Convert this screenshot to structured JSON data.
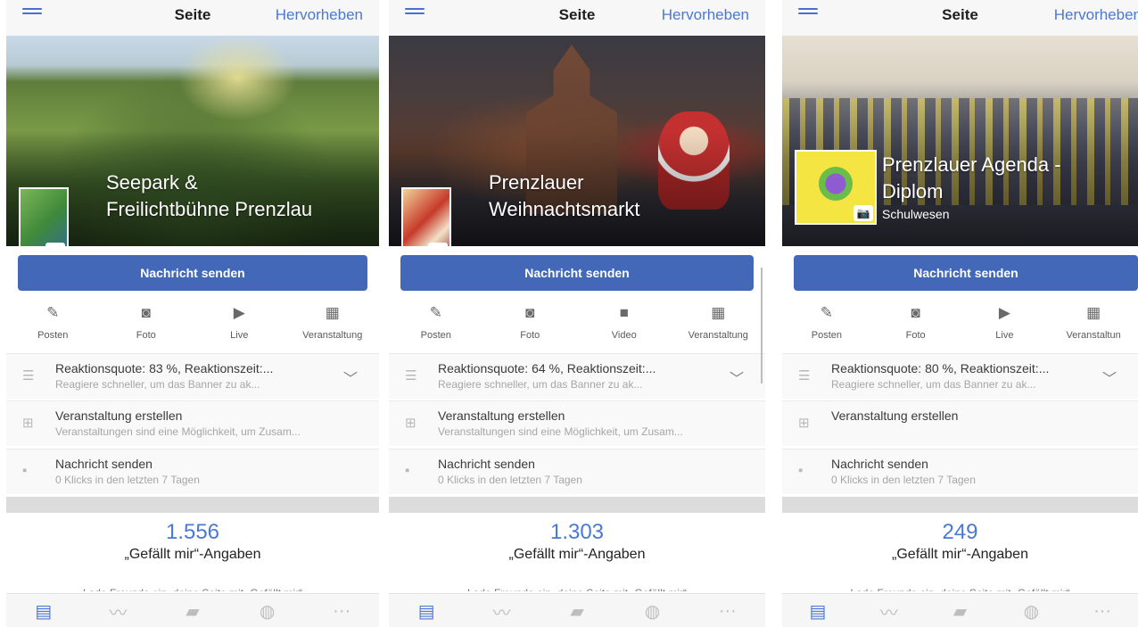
{
  "topbar": {
    "title": "Seite",
    "action": "Hervorheben"
  },
  "icons": {
    "menu": "hamburger-icon",
    "camera": "📷"
  },
  "message_button": "Nachricht senden",
  "likes_label": "„Gefällt mir“-Angaben",
  "invite_text": "Lade Freunde ein, deine Seite mit „Gefällt mir“",
  "tabbar": [
    "▤",
    "〰",
    "▰",
    "◍",
    "···"
  ],
  "panels": [
    {
      "name_line1": "Seepark &",
      "name_line2": "Freilichtbühne Prenzlau",
      "category": "",
      "actions": [
        {
          "icon": "✎",
          "label": "Posten"
        },
        {
          "icon": "◙",
          "label": "Foto"
        },
        {
          "icon": "▶",
          "label": "Live"
        },
        {
          "icon": "▦",
          "label": "Veranstaltung"
        }
      ],
      "rows": [
        {
          "title": "Reaktionsquote: 83 %, Reaktionszeit:...",
          "sub": "Reagiere schneller, um das Banner zu ak..."
        },
        {
          "title": "Veranstaltung erstellen",
          "sub": "Veranstaltungen sind eine Möglichkeit, um Zusam..."
        },
        {
          "title": "Nachricht senden",
          "sub": "0 Klicks in den letzten 7 Tagen"
        }
      ],
      "likes": "1.556"
    },
    {
      "name_line1": "Prenzlauer",
      "name_line2": "Weihnachtsmarkt",
      "category": "",
      "actions": [
        {
          "icon": "✎",
          "label": "Posten"
        },
        {
          "icon": "◙",
          "label": "Foto"
        },
        {
          "icon": "■",
          "label": "Video"
        },
        {
          "icon": "▦",
          "label": "Veranstaltung"
        }
      ],
      "rows": [
        {
          "title": "Reaktionsquote: 64 %, Reaktionszeit:...",
          "sub": "Reagiere schneller, um das Banner zu ak..."
        },
        {
          "title": "Veranstaltung erstellen",
          "sub": "Veranstaltungen sind eine Möglichkeit, um Zusam..."
        },
        {
          "title": "Nachricht senden",
          "sub": "0 Klicks in den letzten 7 Tagen"
        }
      ],
      "likes": "1.303"
    },
    {
      "name_line1": "Prenzlauer Agenda -",
      "name_line2": "Diplom",
      "category": "Schulwesen",
      "actions": [
        {
          "icon": "✎",
          "label": "Posten"
        },
        {
          "icon": "◙",
          "label": "Foto"
        },
        {
          "icon": "▶",
          "label": "Live"
        },
        {
          "icon": "▦",
          "label": "Veranstaltun"
        }
      ],
      "rows": [
        {
          "title": "Reaktionsquote: 80 %, Reaktionszeit:...",
          "sub": "Reagiere schneller, um das Banner zu ak..."
        },
        {
          "title": "Veranstaltung erstellen",
          "sub": ""
        },
        {
          "title": "Nachricht senden",
          "sub": "0 Klicks in den letzten 7 Tagen"
        }
      ],
      "likes": "249"
    }
  ]
}
